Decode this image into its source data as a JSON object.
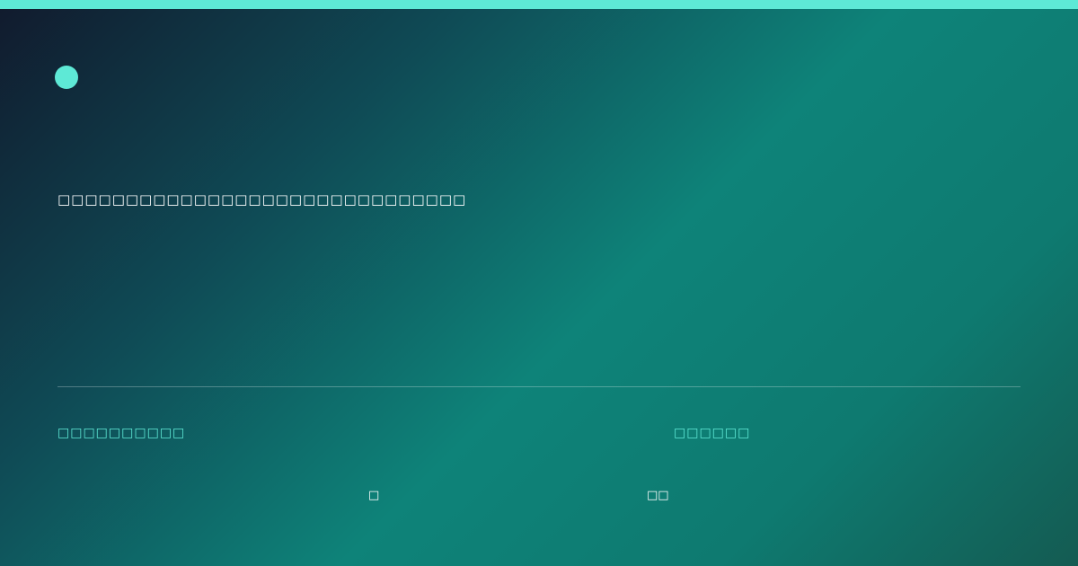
{
  "theme": {
    "accent": "#5ee9d6",
    "bg_start": "#111a2d",
    "bg_mid": "#0e8379",
    "bg_end": "#145b52"
  },
  "brand": {
    "icon": "circle-dot-icon"
  },
  "hero": {
    "headline": "□□□□□□□□□□□□□□□□□□□□□□□□□□□□□□"
  },
  "footer": {
    "meta_left": "□□□□□□□□□□",
    "meta_right": "□□□□□□",
    "glyph_a": "□",
    "glyph_b": "□□"
  }
}
